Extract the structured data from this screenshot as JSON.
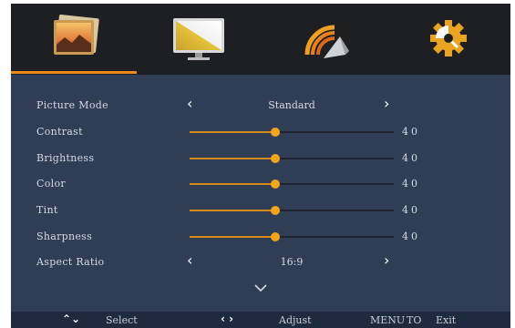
{
  "tabs": [
    {
      "id": "picture",
      "icon": "picture-icon",
      "active": true
    },
    {
      "id": "screen",
      "icon": "monitor-icon",
      "active": false
    },
    {
      "id": "sound",
      "icon": "audio-icon",
      "active": false
    },
    {
      "id": "setup",
      "icon": "gear-icon",
      "active": false
    }
  ],
  "colors": {
    "accent": "#e88b1a",
    "panel": "#2f3d55",
    "topbar": "#1e1f22",
    "knob": "#f4a51a"
  },
  "rows": {
    "picture_mode": {
      "label": "Picture  Mode",
      "value": "Standard"
    },
    "contrast": {
      "label": "Contrast",
      "value": "40"
    },
    "brightness": {
      "label": "Brightness",
      "value": "40"
    },
    "color": {
      "label": "Color",
      "value": "40"
    },
    "tint": {
      "label": "Tint",
      "value": "40"
    },
    "sharpness": {
      "label": "Sharpness",
      "value": "40"
    },
    "aspect_ratio": {
      "label": "Aspect  Ratio",
      "value": "16:9"
    }
  },
  "slider_level": 0.42,
  "icons": {
    "prev": "‹",
    "next": "›",
    "more": "chevron-down-icon"
  },
  "footer": {
    "select_glyph": "⌃⌄",
    "select": "Select",
    "adjust_glyph": "‹ ›",
    "adjust": "Adjust",
    "menu": "MENU",
    "to": "TO",
    "exit": "Exit"
  }
}
